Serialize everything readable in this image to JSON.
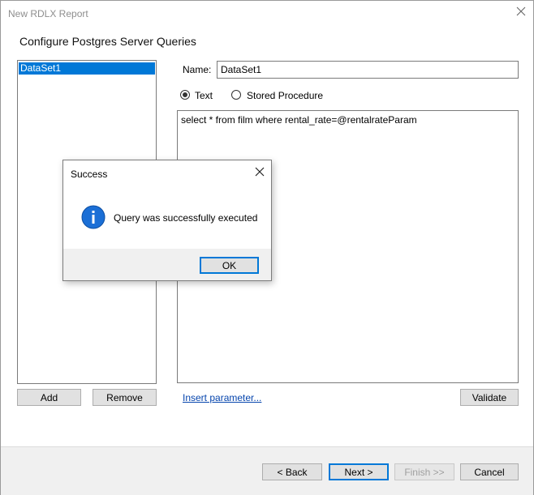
{
  "window": {
    "title": "New RDLX Report",
    "heading": "Configure Postgres Server Queries"
  },
  "datasets": {
    "items": [
      "DataSet1"
    ],
    "add_label": "Add",
    "remove_label": "Remove"
  },
  "editor": {
    "name_label": "Name:",
    "name_value": "DataSet1",
    "radio_text_label": "Text",
    "radio_text_checked": true,
    "radio_sp_label": "Stored Procedure",
    "query": "select * from film where rental_rate=@rentalrateParam",
    "insert_parameter_label": "Insert parameter...",
    "validate_label": "Validate"
  },
  "footer": {
    "back_label": "< Back",
    "next_label": "Next >",
    "finish_label": "Finish >>",
    "cancel_label": "Cancel"
  },
  "dialog": {
    "title": "Success",
    "message": "Query was successfully executed",
    "ok_label": "OK",
    "icon": "info-icon"
  },
  "colors": {
    "accent": "#0078d7",
    "link": "#0645ad"
  }
}
